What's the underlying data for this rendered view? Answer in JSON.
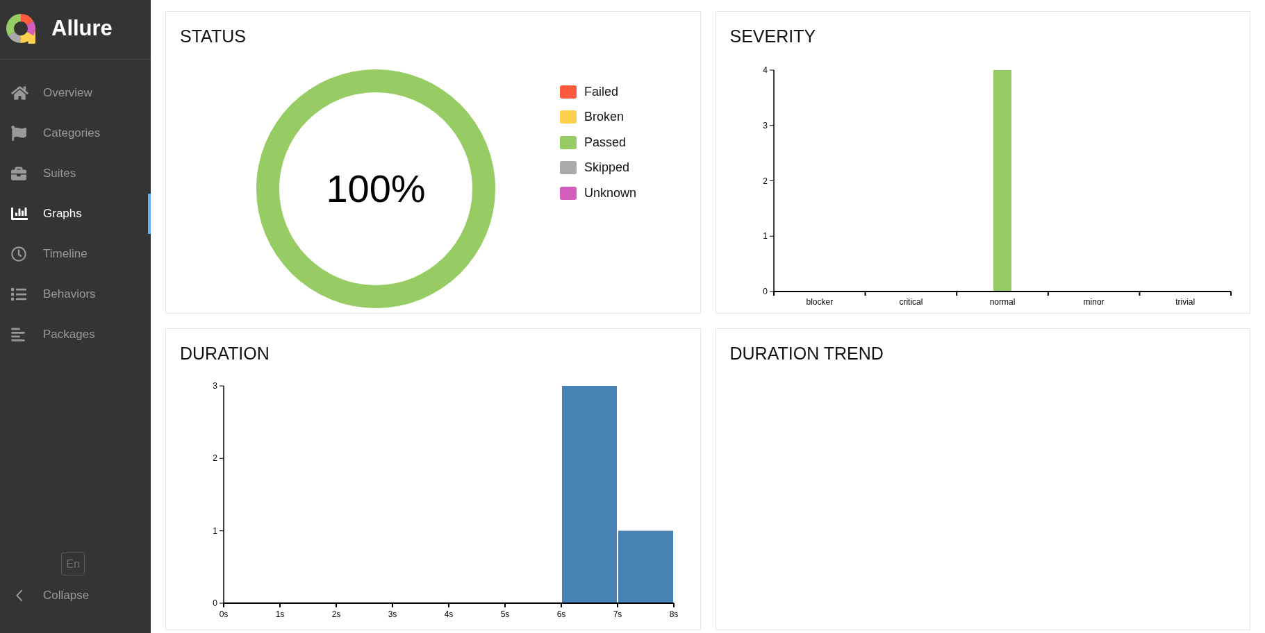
{
  "sidebar": {
    "brand": "Allure",
    "items": [
      {
        "label": "Overview",
        "selected": false
      },
      {
        "label": "Categories",
        "selected": false
      },
      {
        "label": "Suites",
        "selected": false
      },
      {
        "label": "Graphs",
        "selected": true
      },
      {
        "label": "Timeline",
        "selected": false
      },
      {
        "label": "Behaviors",
        "selected": false
      },
      {
        "label": "Packages",
        "selected": false
      }
    ],
    "language": "En",
    "collapse": "Collapse"
  },
  "status": {
    "title": "STATUS",
    "center_label": "100%",
    "legend": [
      {
        "label": "Failed",
        "color": "#fd5a3e"
      },
      {
        "label": "Broken",
        "color": "#ffd050"
      },
      {
        "label": "Passed",
        "color": "#97cc64"
      },
      {
        "label": "Skipped",
        "color": "#aaaaaa"
      },
      {
        "label": "Unknown",
        "color": "#d35ebe"
      }
    ],
    "chart_data": {
      "type": "pie",
      "values": [
        0,
        0,
        100,
        0,
        0
      ]
    }
  },
  "severity": {
    "title": "SEVERITY",
    "chart_data": {
      "type": "bar",
      "categories": [
        "blocker",
        "critical",
        "normal",
        "minor",
        "trivial"
      ],
      "values": [
        0,
        0,
        4,
        0,
        0
      ],
      "ylim": [
        0,
        4
      ],
      "yticks": [
        0,
        1,
        2,
        3,
        4
      ]
    }
  },
  "duration": {
    "title": "DURATION",
    "chart_data": {
      "type": "bar",
      "x": [
        6.5,
        7.5
      ],
      "values": [
        3,
        1
      ],
      "xlim": [
        0,
        8
      ],
      "xticks": [
        {
          "value": 0,
          "label": "0s"
        },
        {
          "value": 1,
          "label": "1s"
        },
        {
          "value": 2,
          "label": "2s"
        },
        {
          "value": 3,
          "label": "3s"
        },
        {
          "value": 4,
          "label": "4s"
        },
        {
          "value": 5,
          "label": "5s"
        },
        {
          "value": 6,
          "label": "6s"
        },
        {
          "value": 7,
          "label": "7s"
        },
        {
          "value": 8,
          "label": "8s"
        }
      ],
      "ylim": [
        0,
        3
      ],
      "yticks": [
        0,
        1,
        2,
        3
      ]
    }
  },
  "duration_trend": {
    "title": "DURATION TREND"
  }
}
